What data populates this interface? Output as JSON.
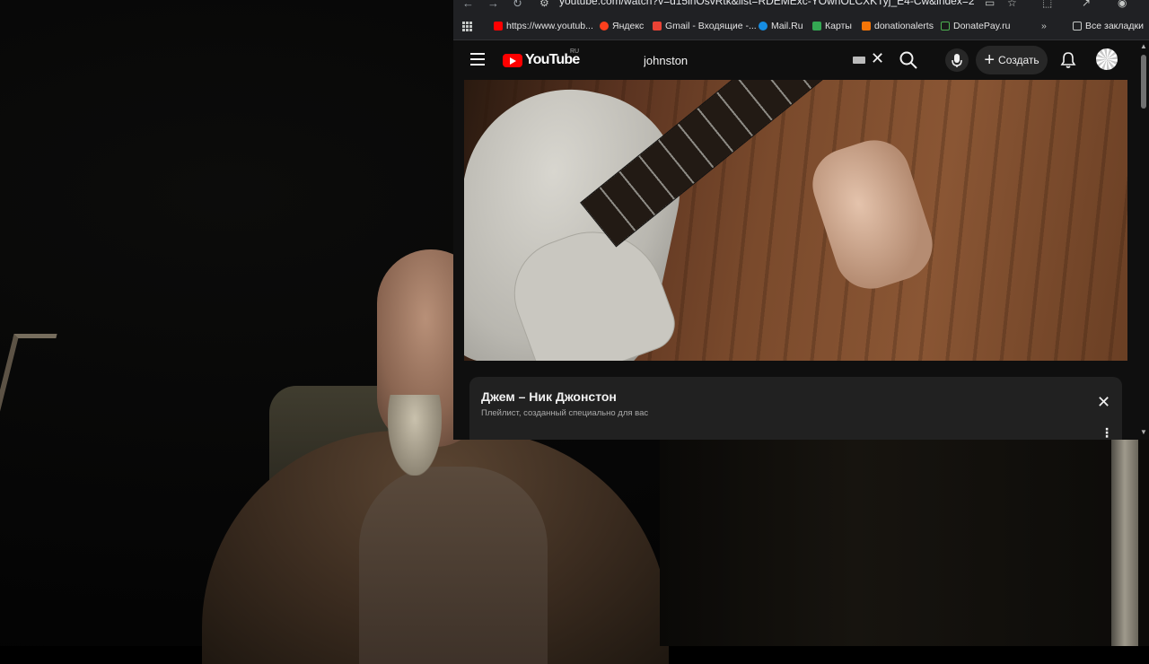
{
  "browser": {
    "url": "youtube.com/watch?v=d15lnOsvRtk&list=RDEMExc-YOwnOLCXKTyj_E4-Cw&index=2",
    "bookmarks": [
      {
        "label": "https://www.youtub...",
        "color": "#ff0000"
      },
      {
        "label": "Яндекс",
        "color": "#fc3f1d"
      },
      {
        "label": "Gmail - Входящие -...",
        "color": "#ea4335"
      },
      {
        "label": "Mail.Ru",
        "color": "#168de2"
      },
      {
        "label": "Карты",
        "color": "#34a853"
      },
      {
        "label": "donationalerts",
        "color": "#f57507"
      },
      {
        "label": "DonatePay.ru",
        "color": "#1a1a1a"
      }
    ],
    "all_bookmarks_label": "Все закладки"
  },
  "youtube": {
    "logo_text": "YouTube",
    "country_code": "RU",
    "search_value": "johnston",
    "create_label": "Создать"
  },
  "playlist": {
    "title": "Джем – Ник Джонстон",
    "subtitle": "Плейлист, созданный специально для вас"
  },
  "colors": {
    "accent": "#ff0000",
    "background": "#0f0f0f",
    "panel": "#212121"
  }
}
